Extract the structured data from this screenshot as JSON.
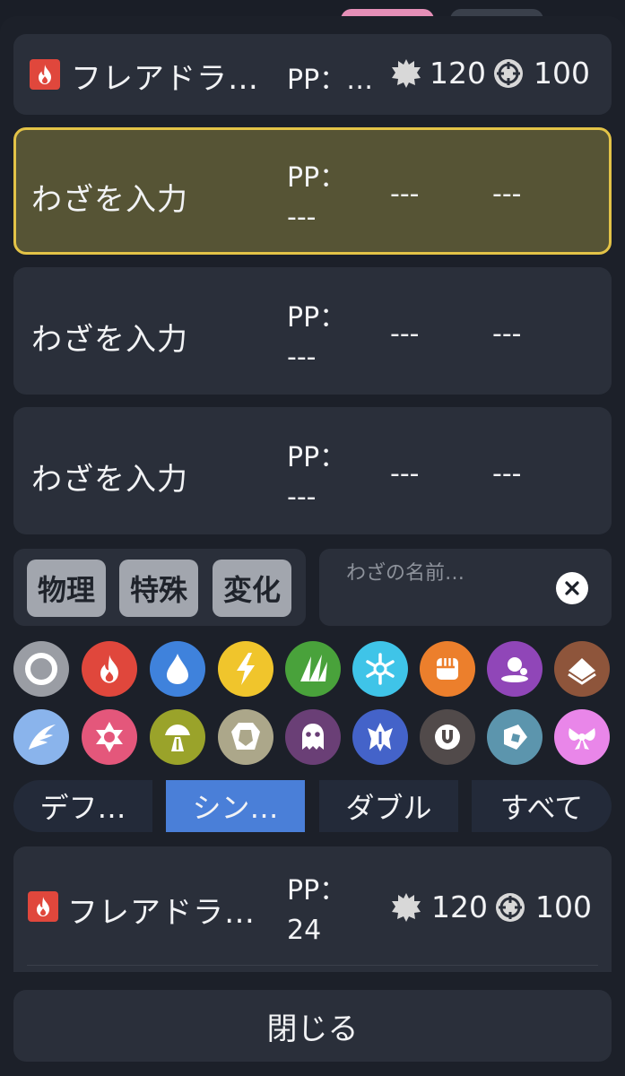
{
  "colors": {
    "background": "#1a1e27",
    "card": "#2a2f3a",
    "selected_card": "#565435",
    "selected_border": "#e3c347",
    "active_segment": "#4a7fd8",
    "fire": "#e0473c"
  },
  "current_moves": [
    {
      "type_icon": "fire-icon",
      "name": "フレアドラ…",
      "pp_label": "PP：…",
      "power": "120",
      "accuracy": "100"
    },
    {
      "name": "わざを入力",
      "pp_label": "PP：",
      "pp_value": "---",
      "power": "---",
      "accuracy": "---"
    },
    {
      "name": "わざを入力",
      "pp_label": "PP：",
      "pp_value": "---",
      "power": "---",
      "accuracy": "---"
    },
    {
      "name": "わざを入力",
      "pp_label": "PP：",
      "pp_value": "---",
      "power": "---",
      "accuracy": "---"
    }
  ],
  "category_filters": [
    "物理",
    "特殊",
    "変化"
  ],
  "search": {
    "placeholder": "わざの名前…"
  },
  "type_filters": [
    "normal",
    "fire",
    "water",
    "electric",
    "grass",
    "ice",
    "fighting",
    "poison",
    "ground",
    "flying",
    "psychic",
    "bug",
    "rock",
    "ghost",
    "dragon",
    "dark",
    "steel",
    "fairy"
  ],
  "format_tabs": {
    "items": [
      "デフ…",
      "シン…",
      "ダブル",
      "すべて"
    ],
    "selected": "シン…"
  },
  "results": [
    {
      "type_icon": "fire-icon",
      "name": "フレアドラ…",
      "pp_label": "PP：",
      "pp_value": "24",
      "power": "120",
      "accuracy": "100"
    }
  ],
  "close_label": "閉じる"
}
